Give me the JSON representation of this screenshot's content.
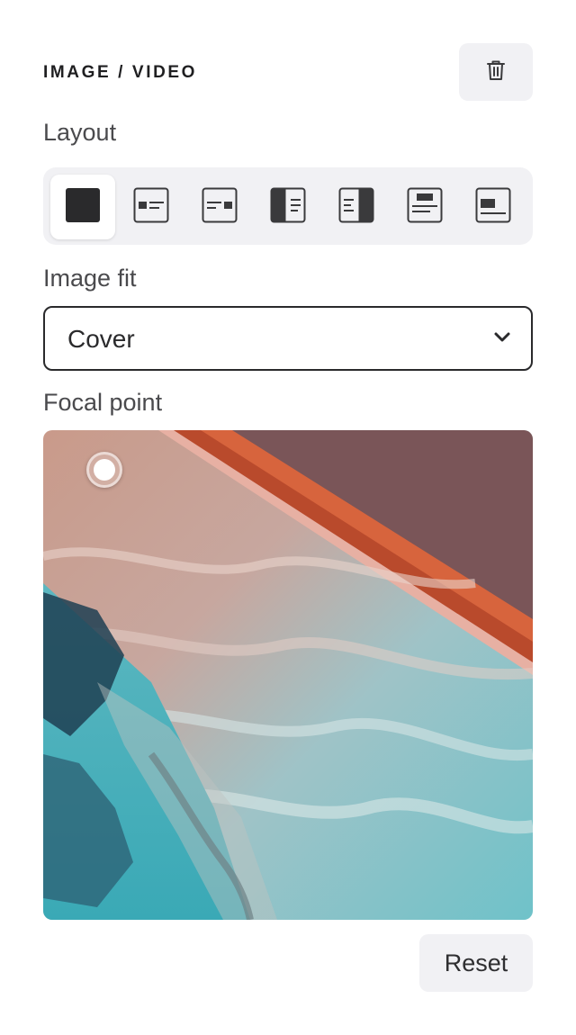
{
  "panel": {
    "title": "IMAGE / VIDEO",
    "delete_icon": "trash-icon"
  },
  "layout": {
    "label": "Layout",
    "selected_index": 0,
    "options": [
      {
        "name": "full-bleed",
        "icon": "layout-full-icon"
      },
      {
        "name": "media-left-inline",
        "icon": "layout-media-left-inline-icon"
      },
      {
        "name": "media-right-inline",
        "icon": "layout-media-right-inline-icon"
      },
      {
        "name": "media-left-split",
        "icon": "layout-split-left-icon"
      },
      {
        "name": "media-right-split",
        "icon": "layout-split-right-icon"
      },
      {
        "name": "media-top",
        "icon": "layout-media-top-icon"
      },
      {
        "name": "media-bottom",
        "icon": "layout-media-bottom-icon"
      }
    ]
  },
  "image_fit": {
    "label": "Image fit",
    "value": "Cover"
  },
  "focal_point": {
    "label": "Focal point"
  },
  "actions": {
    "reset_label": "Reset"
  },
  "colors": {
    "accent_dark": "#2a2a2c",
    "surface": "#f1f1f4"
  }
}
